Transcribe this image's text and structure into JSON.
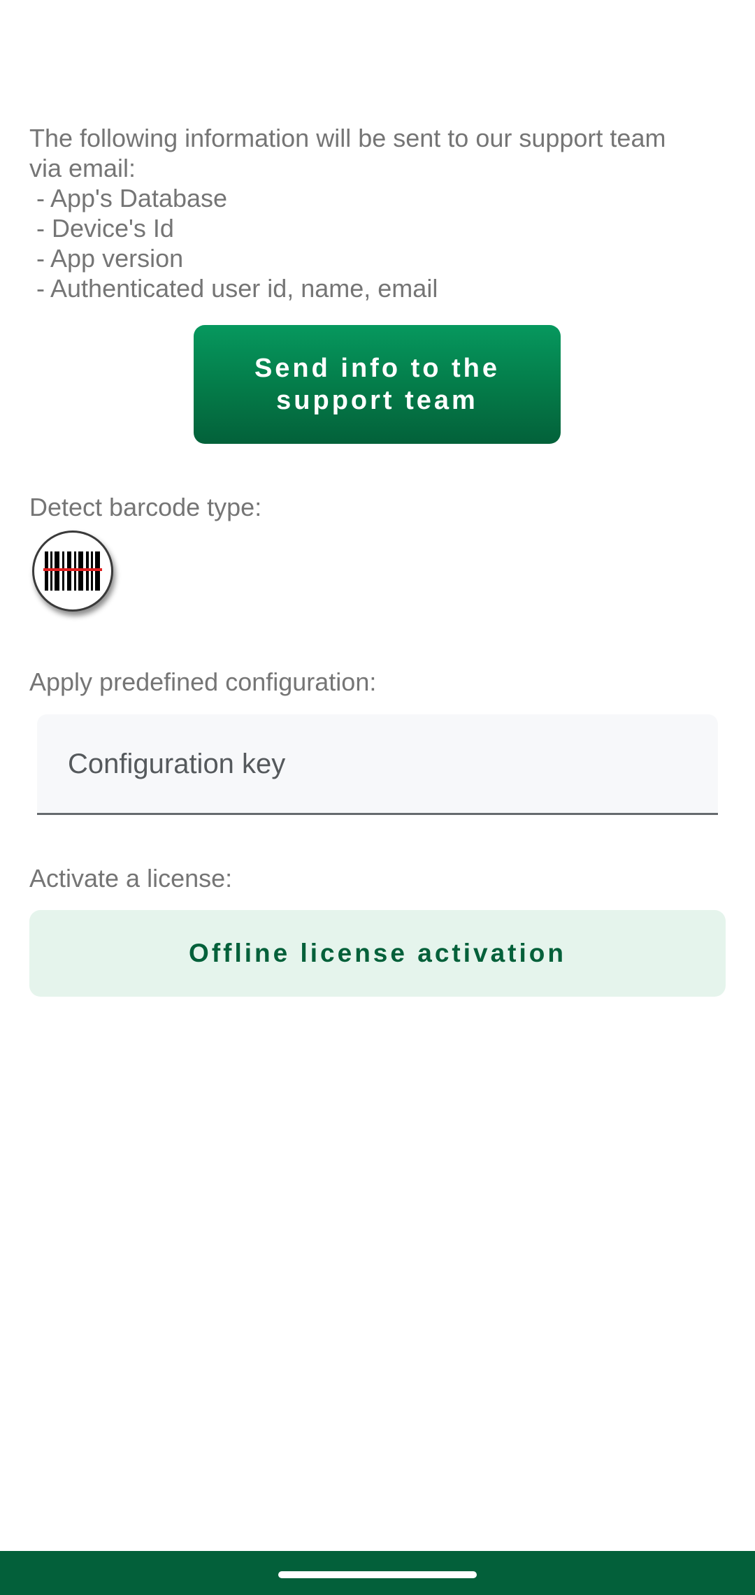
{
  "info": {
    "intro_line1": "The following information will be sent to our support team",
    "intro_line2": "via email:",
    "items": [
      " - App's Database",
      " - Device's Id",
      " - App version",
      " - Authenticated user id, name, email"
    ]
  },
  "support": {
    "send_label_line1": "Send info to the",
    "send_label_line2": "support team"
  },
  "barcode": {
    "label": "Detect barcode type:",
    "icon": "barcode-scan-icon"
  },
  "configuration": {
    "label": "Apply predefined configuration:",
    "placeholder": "Configuration key",
    "value": ""
  },
  "license": {
    "label": "Activate a license:",
    "button_label": "Offline license activation"
  },
  "colors": {
    "primary": "#047a48",
    "primary_dark": "#03603a",
    "tonal": "#e5f4ec",
    "text_secondary": "#757575"
  }
}
